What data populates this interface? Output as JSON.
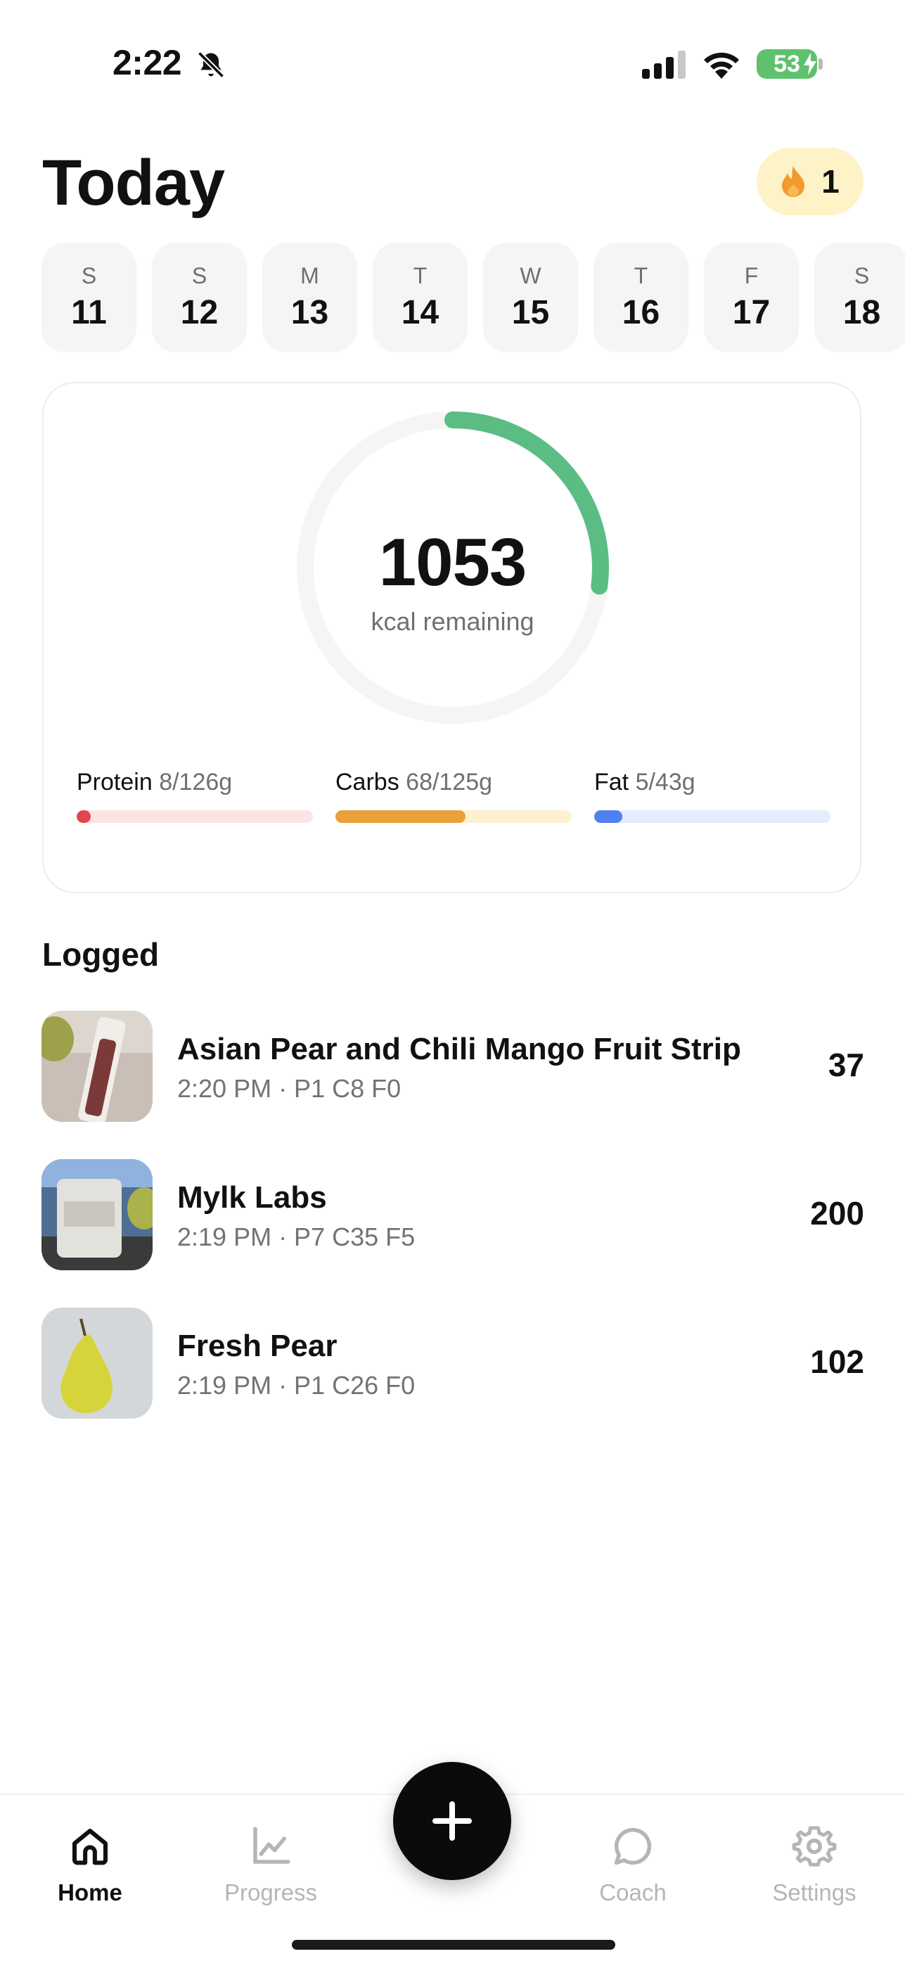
{
  "status_bar": {
    "time": "2:22",
    "battery": "53"
  },
  "header": {
    "title": "Today",
    "streak_count": "1"
  },
  "days": [
    {
      "letter": "S",
      "num": "11"
    },
    {
      "letter": "S",
      "num": "12"
    },
    {
      "letter": "M",
      "num": "13"
    },
    {
      "letter": "T",
      "num": "14"
    },
    {
      "letter": "W",
      "num": "15"
    },
    {
      "letter": "T",
      "num": "16"
    },
    {
      "letter": "F",
      "num": "17"
    },
    {
      "letter": "S",
      "num": "18"
    }
  ],
  "summary": {
    "kcal_remaining": "1053",
    "kcal_label": "kcal remaining",
    "ring_progress": 0.27,
    "ring_color": "#5bbd84",
    "macros": [
      {
        "name": "Protein",
        "value": "8/126g",
        "progress": 0.06,
        "fill": "#e0474c",
        "track": "#fde4e4"
      },
      {
        "name": "Carbs",
        "value": "68/125g",
        "progress": 0.55,
        "fill": "#eaa13a",
        "track": "#fdf1cf"
      },
      {
        "name": "Fat",
        "value": "5/43g",
        "progress": 0.12,
        "fill": "#4f7ff0",
        "track": "#e4ecfd"
      }
    ]
  },
  "logged": {
    "title": "Logged",
    "items": [
      {
        "name": "Asian Pear and Chili Mango Fruit Strip",
        "meta": "2:20 PM · P1 C8 F0",
        "kcal": "37"
      },
      {
        "name": "Mylk Labs",
        "meta": "2:19 PM · P7 C35 F5",
        "kcal": "200"
      },
      {
        "name": "Fresh Pear",
        "meta": "2:19 PM · P1 C26 F0",
        "kcal": "102"
      }
    ]
  },
  "tabs": {
    "home": "Home",
    "progress": "Progress",
    "coach": "Coach",
    "settings": "Settings"
  },
  "icons": {
    "bell": "bell-slash-icon",
    "signal": "cellular-signal-icon",
    "wifi": "wifi-icon",
    "streak": "flame-icon",
    "home": "house-icon",
    "progress": "chart-line-icon",
    "add": "plus-icon",
    "coach": "chat-bubble-icon",
    "settings": "gear-icon"
  }
}
